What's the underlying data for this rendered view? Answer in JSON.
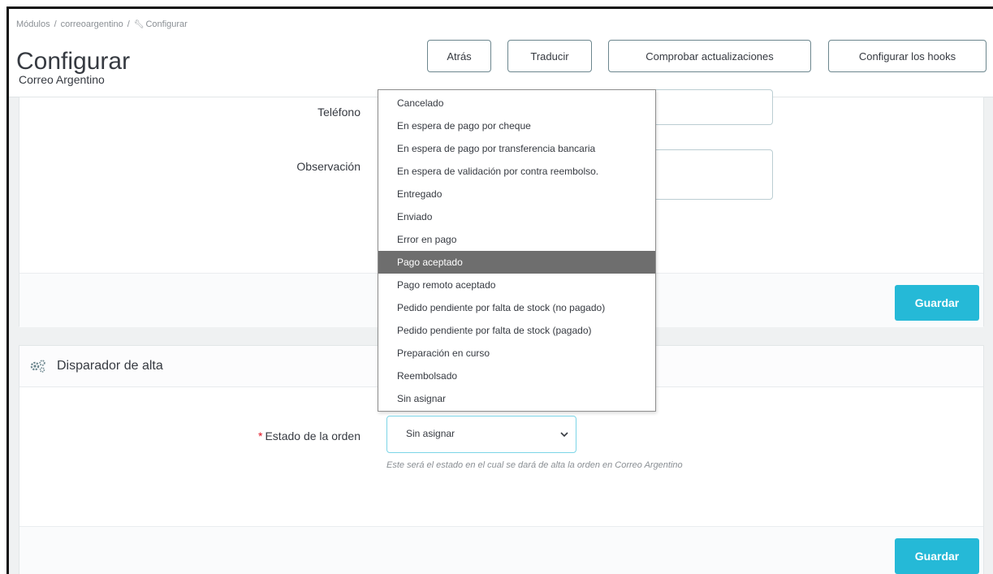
{
  "breadcrumb": {
    "items": [
      "Módulos",
      "correoargentino",
      "Configurar"
    ]
  },
  "header": {
    "title": "Configurar",
    "subtitle": "Correo Argentino"
  },
  "toolbar": {
    "back": "Atrás",
    "translate": "Traducir",
    "check_updates": "Comprobar actualizaciones",
    "configure_hooks": "Configurar los hooks"
  },
  "panel1": {
    "phone_label": "Teléfono",
    "observation_label": "Observación",
    "save": "Guardar"
  },
  "panel2": {
    "title": "Disparador de alta",
    "order_state_label": "Estado de la orden",
    "required_mark": "*",
    "selected_value": "Sin asignar",
    "help": "Este será el estado en el cual se dará de alta la orden en Correo Argentino",
    "save": "Guardar"
  },
  "dropdown": {
    "highlighted": "Pago aceptado",
    "options": [
      "Cancelado",
      "En espera de pago por cheque",
      "En espera de pago por transferencia bancaria",
      "En espera de validación por contra reembolso.",
      "Entregado",
      "Enviado",
      "Error en pago",
      "Pago aceptado",
      "Pago remoto aceptado",
      "Pedido pendiente por falta de stock (no pagado)",
      "Pedido pendiente por falta de stock (pagado)",
      "Preparación en curso",
      "Reembolsado",
      "Sin asignar"
    ]
  },
  "colors": {
    "primary": "#25b9d7",
    "highlight": "#6e6e6e",
    "required": "#e0101f"
  }
}
